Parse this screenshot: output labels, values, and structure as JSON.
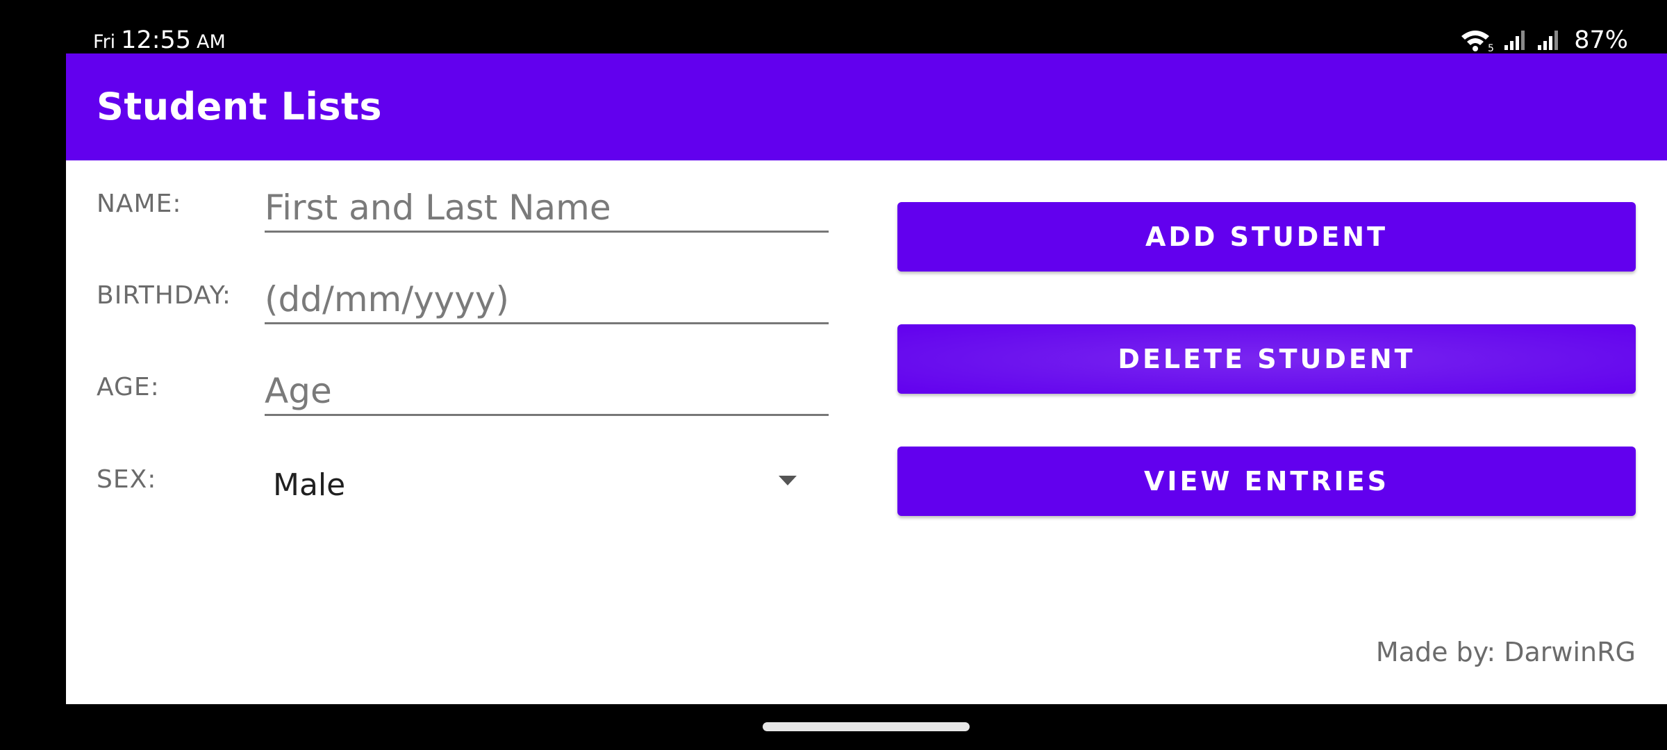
{
  "status_bar": {
    "day": "Fri",
    "time": "12:55",
    "ampm": "AM",
    "wifi_icon": "wifi-icon",
    "wifi_badge": "5",
    "signal_icon": "signal-icon",
    "battery": "87%"
  },
  "app_bar": {
    "title": "Student Lists"
  },
  "form": {
    "name": {
      "label": "NAME:",
      "value": "",
      "placeholder": "First and Last Name"
    },
    "birthday": {
      "label": "BIRTHDAY:",
      "value": "",
      "placeholder": "(dd/mm/yyyy)"
    },
    "age": {
      "label": "AGE:",
      "value": "",
      "placeholder": "Age"
    },
    "sex": {
      "label": "SEX:",
      "value": "Male"
    }
  },
  "actions": {
    "add": "ADD STUDENT",
    "delete": "DELETE STUDENT",
    "view": "VIEW ENTRIES"
  },
  "footer": {
    "credit": "Made by: DarwinRG"
  },
  "colors": {
    "primary": "#6200EE",
    "background": "#FFFFFF",
    "label": "#6B6B6B"
  }
}
